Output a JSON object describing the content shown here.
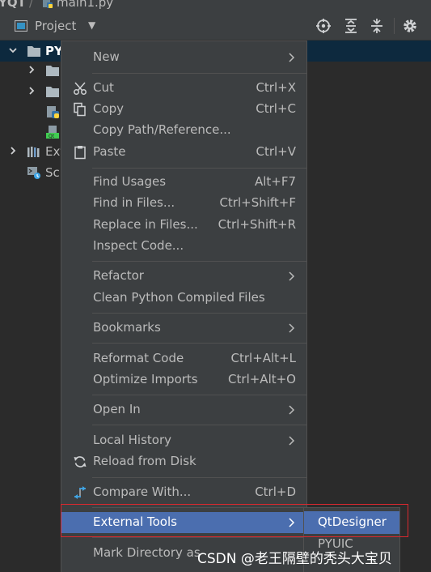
{
  "breadcrumb": {
    "project": "YQT",
    "separator": "/",
    "file": "main1.py"
  },
  "toolbar": {
    "title": "Project",
    "icons": [
      "project-view-icon",
      "locate-icon",
      "expand-all-icon",
      "collapse-all-icon",
      "settings-icon"
    ]
  },
  "tree": {
    "rows": [
      {
        "label": "PY",
        "icon": "folder-icon",
        "expanded": true,
        "selected": true
      },
      {
        "label": "",
        "icon": "folder-icon",
        "expanded": false
      },
      {
        "label": "",
        "icon": "folder-icon",
        "expanded": false
      },
      {
        "label": "",
        "icon": "python-file-icon"
      },
      {
        "label": "",
        "icon": "qt-file-icon"
      },
      {
        "label": "Ext",
        "icon": "external-libraries-icon",
        "expanded": false
      },
      {
        "label": "Sc",
        "icon": "scratches-icon"
      }
    ]
  },
  "menu": {
    "items": [
      {
        "label": "New",
        "shortcut": "",
        "submenu": true,
        "icon": ""
      },
      {
        "label": "Cut",
        "shortcut": "Ctrl+X",
        "submenu": false,
        "icon": "cut-icon"
      },
      {
        "label": "Copy",
        "shortcut": "Ctrl+C",
        "submenu": false,
        "icon": "copy-icon"
      },
      {
        "label": "Copy Path/Reference...",
        "shortcut": "",
        "submenu": false,
        "icon": ""
      },
      {
        "label": "Paste",
        "shortcut": "Ctrl+V",
        "submenu": false,
        "icon": "paste-icon"
      },
      {
        "label": "Find Usages",
        "shortcut": "Alt+F7",
        "submenu": false,
        "icon": ""
      },
      {
        "label": "Find in Files...",
        "shortcut": "Ctrl+Shift+F",
        "submenu": false,
        "icon": ""
      },
      {
        "label": "Replace in Files...",
        "shortcut": "Ctrl+Shift+R",
        "submenu": false,
        "icon": ""
      },
      {
        "label": "Inspect Code...",
        "shortcut": "",
        "submenu": false,
        "icon": ""
      },
      {
        "label": "Refactor",
        "shortcut": "",
        "submenu": true,
        "icon": ""
      },
      {
        "label": "Clean Python Compiled Files",
        "shortcut": "",
        "submenu": false,
        "icon": ""
      },
      {
        "label": "Bookmarks",
        "shortcut": "",
        "submenu": true,
        "icon": ""
      },
      {
        "label": "Reformat Code",
        "shortcut": "Ctrl+Alt+L",
        "submenu": false,
        "icon": ""
      },
      {
        "label": "Optimize Imports",
        "shortcut": "Ctrl+Alt+O",
        "submenu": false,
        "icon": ""
      },
      {
        "label": "Open In",
        "shortcut": "",
        "submenu": true,
        "icon": ""
      },
      {
        "label": "Local History",
        "shortcut": "",
        "submenu": true,
        "icon": ""
      },
      {
        "label": "Reload from Disk",
        "shortcut": "",
        "submenu": false,
        "icon": "reload-icon"
      },
      {
        "label": "Compare With...",
        "shortcut": "Ctrl+D",
        "submenu": false,
        "icon": "compare-icon"
      },
      {
        "label": "External Tools",
        "shortcut": "",
        "submenu": true,
        "icon": "",
        "active": true
      },
      {
        "label": "Mark Directory as",
        "shortcut": "",
        "submenu": true,
        "icon": ""
      }
    ]
  },
  "submenu": {
    "items": [
      {
        "label": "QtDesigner",
        "active": true
      },
      {
        "label": "PYUIC",
        "active": false
      }
    ]
  },
  "watermark": "CSDN @老王隔壁的秃头大宝贝",
  "colors": {
    "background": "#2b2b2b",
    "panel": "#3c3f41",
    "selection": "#4b6eaf",
    "tree_selection": "#0d293e",
    "text": "#bbbbbb",
    "highlight_border": "#d9282f"
  }
}
